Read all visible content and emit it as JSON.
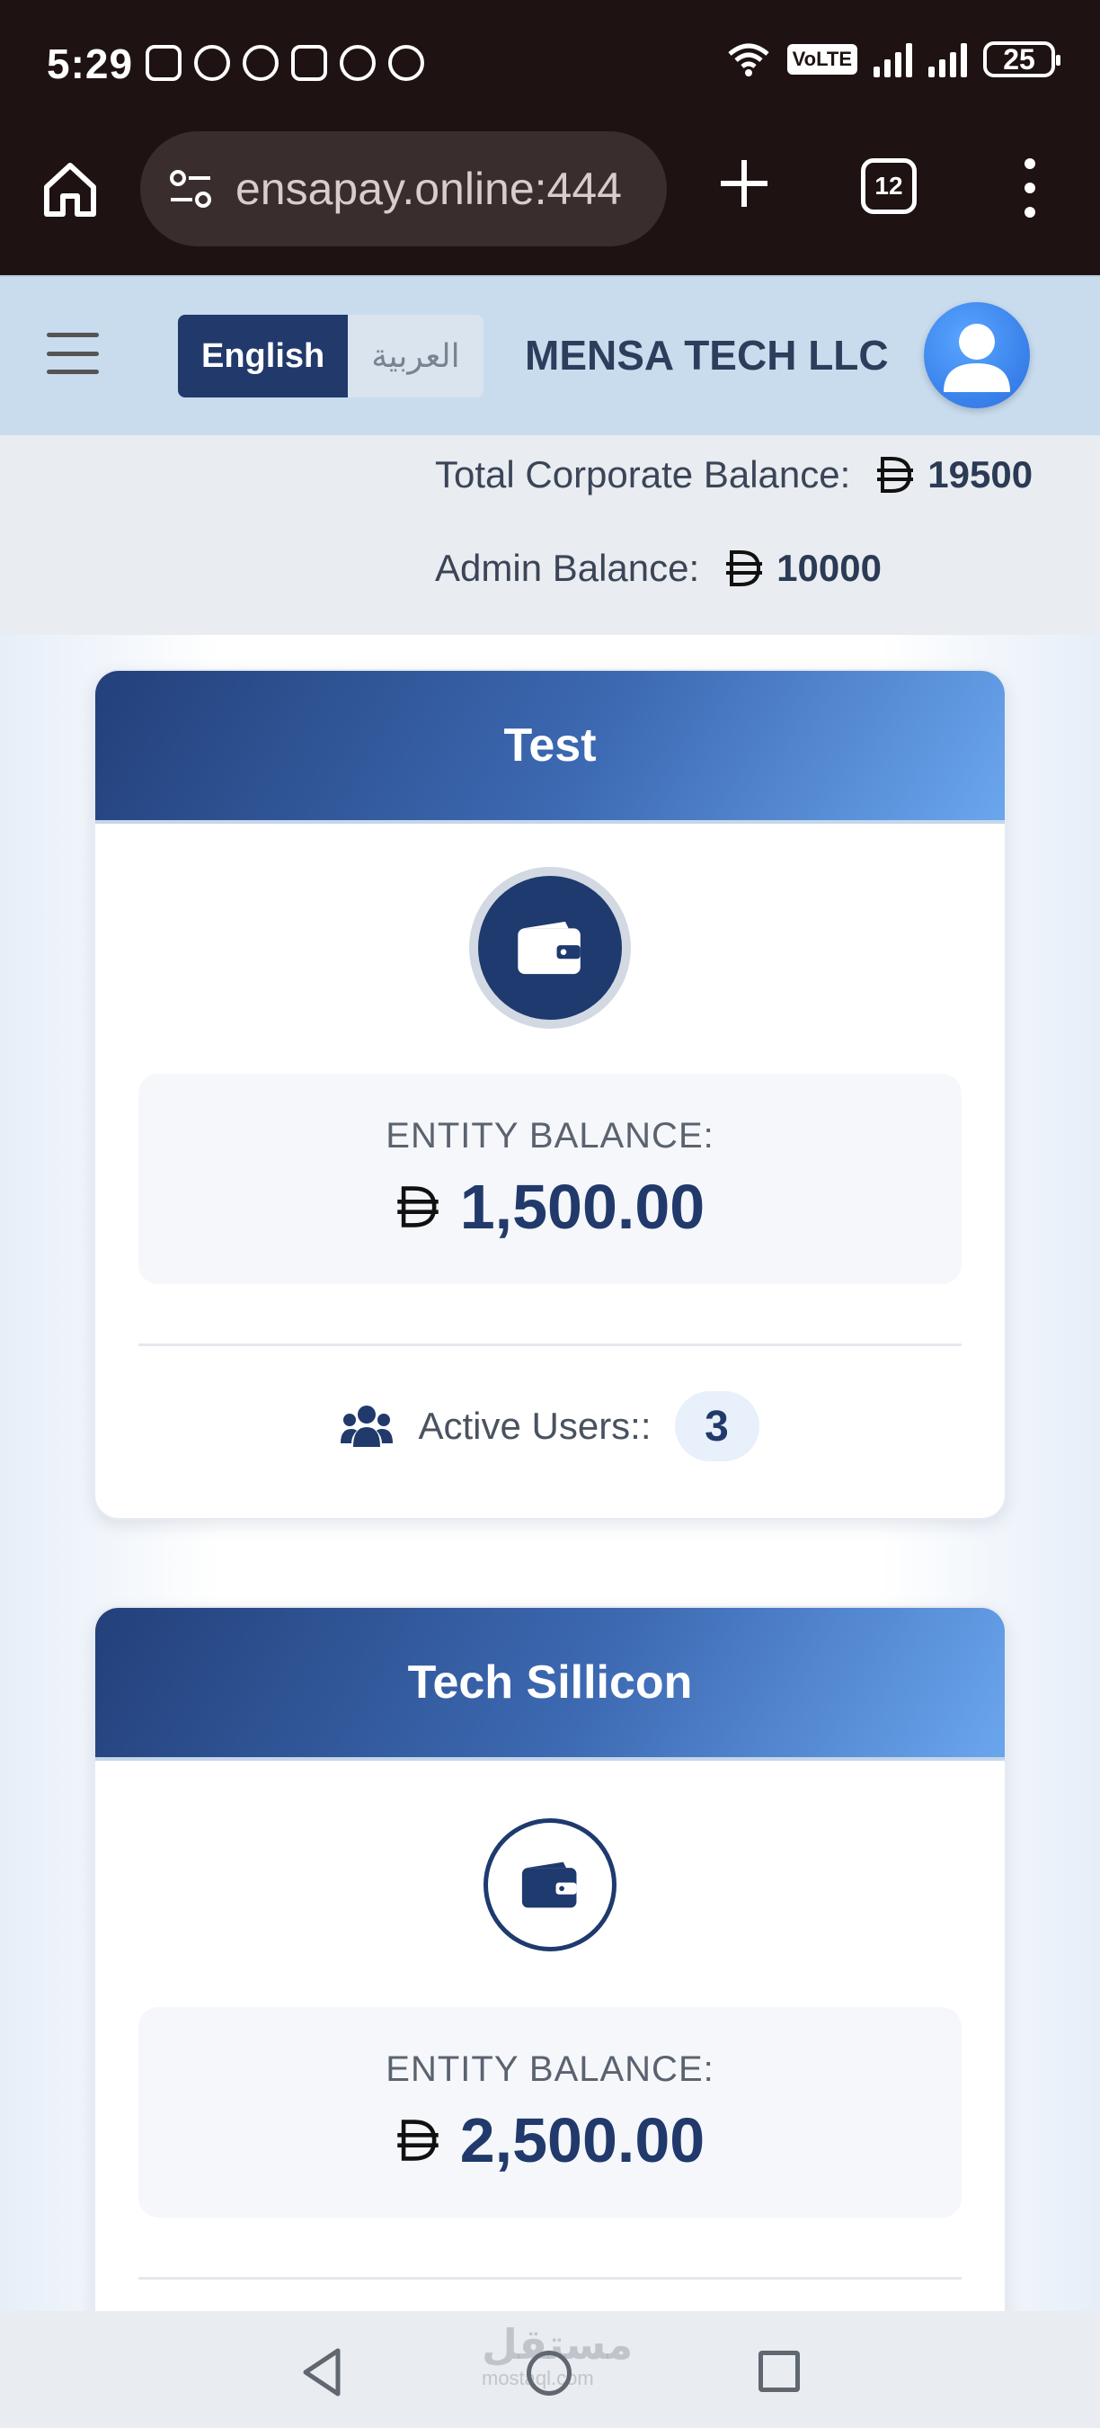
{
  "status_bar": {
    "time": "5:29",
    "volte": "VoLTE",
    "battery": "25",
    "left_icons": [
      "nfc-icon",
      "alarm-icon",
      "headphones-icon",
      "battery-saver-icon",
      "chat-icon",
      "imo-icon"
    ]
  },
  "browser": {
    "url": "ensapay.online:444",
    "tab_count": "12"
  },
  "header": {
    "lang_en": "English",
    "lang_ar": "العربية",
    "company": "MENSA TECH LLC"
  },
  "balances": {
    "corporate_label": "Total Corporate Balance:",
    "corporate_value": "19500",
    "admin_label": "Admin Balance:",
    "admin_value": "10000"
  },
  "cards": [
    {
      "title": "Test",
      "balance_label": "ENTITY BALANCE:",
      "balance_value": "1,500.00",
      "users_label": "Active Users::",
      "users_count": "3"
    },
    {
      "title": "Tech Sillicon",
      "balance_label": "ENTITY BALANCE:",
      "balance_value": "2,500.00"
    }
  ],
  "watermark": {
    "text": "مستقل",
    "sub": "mostaql.com"
  },
  "colors": {
    "primary": "#213a6b",
    "header_bg": "#c8dcee",
    "card_gradient_start": "#23407a",
    "card_gradient_end": "#6aa6ee"
  }
}
